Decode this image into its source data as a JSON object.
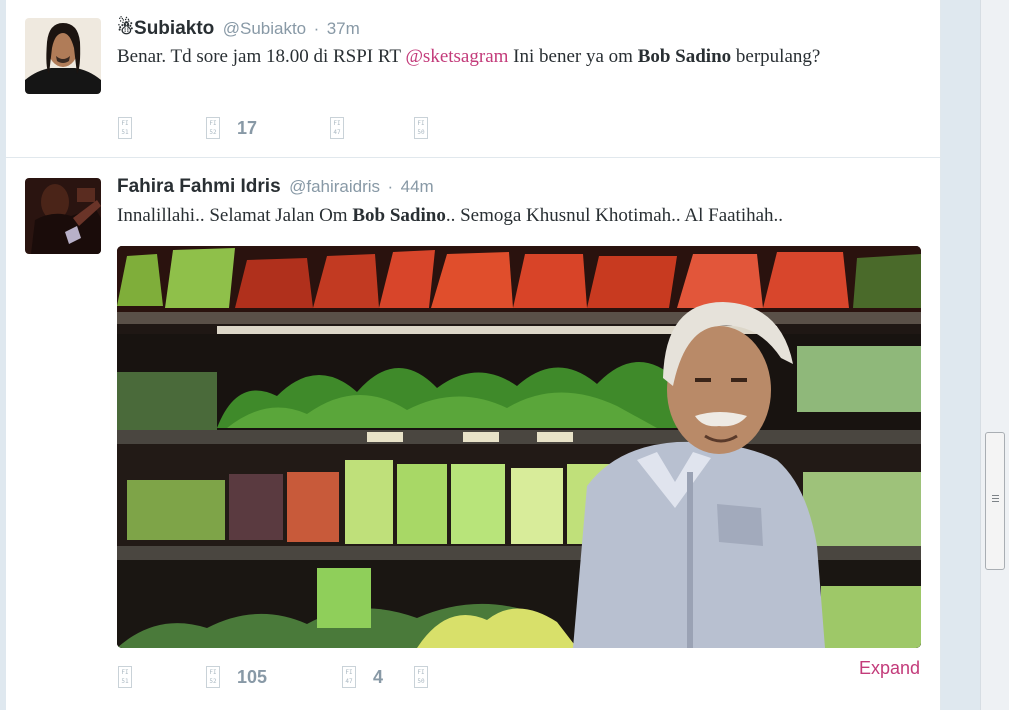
{
  "tweets": [
    {
      "fullname": "☃Subiakto",
      "username": "@Subiakto",
      "separator": "·",
      "time": "37m",
      "text": {
        "part1": "Benar. Td sore jam 18.00 di RSPI RT ",
        "mention": "@sketsagram",
        "part2": " Ini bener ya om ",
        "bold": "Bob Sadino",
        "part3": " berpulang?"
      },
      "actions": {
        "reply_icon_text": "FI 51",
        "retweet_icon_text": "FI 52",
        "retweet_count": "17",
        "favorite_icon_text": "FI 47",
        "more_icon_text": "FI 50"
      }
    },
    {
      "fullname": "Fahira Fahmi Idris",
      "username": "@fahiraidris",
      "separator": "·",
      "time": "44m",
      "text": {
        "part1": "Innalillahi.. Selamat Jalan Om ",
        "bold": "Bob Sadino",
        "part2": ".. Semoga Khusnul Khotimah.. Al Faatihah.."
      },
      "actions": {
        "reply_icon_text": "FI 51",
        "retweet_icon_text": "FI 52",
        "retweet_count": "105",
        "favorite_icon_text": "FI 47",
        "favorite_count": "4",
        "more_icon_text": "FI 50"
      },
      "expand_label": "Expand"
    }
  ],
  "colors": {
    "link": "#c33b7a",
    "meta": "#8899a6",
    "text": "#292f33"
  }
}
